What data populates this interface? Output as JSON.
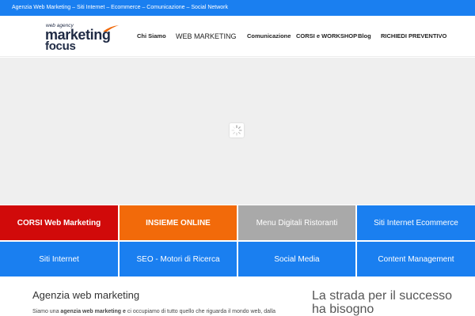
{
  "topbar": {
    "text": "Agenzia Web Marketing – Siti Internet – Ecommerce – Comunicazione – Social Network"
  },
  "logo": {
    "small": "web agency",
    "main": "marketing",
    "sub": "focus"
  },
  "nav": {
    "items": [
      {
        "label": "Chi Siamo"
      },
      {
        "label": "WEB MARKETING"
      },
      {
        "label": "Comunicazione"
      },
      {
        "label": "CORSI e WORKSHOP"
      },
      {
        "label": "Blog"
      },
      {
        "label": "RICHIEDI PREVENTIVO"
      }
    ]
  },
  "tiles": [
    {
      "label": "CORSI Web Marketing",
      "color": "#d10a0a"
    },
    {
      "label": "INSIEME ONLINE",
      "color": "#f26a0a"
    },
    {
      "label": "Menu Digitali Ristoranti",
      "color": "#a9a9a9"
    },
    {
      "label": "Siti Internet Ecommerce",
      "color": "#1a7ff0"
    },
    {
      "label": "Siti Internet",
      "color": "#1a7ff0"
    },
    {
      "label": "SEO - Motori di Ricerca",
      "color": "#1a7ff0"
    },
    {
      "label": "Social Media",
      "color": "#1a7ff0"
    },
    {
      "label": "Content Management",
      "color": "#1a7ff0"
    }
  ],
  "content": {
    "title": "Agenzia web marketing",
    "text_start": "Siamo una ",
    "text_bold": "agenzia web marketing e",
    "text_end": " ci occupiamo di tutto quello che riguarda il mondo web, dalla"
  },
  "side": {
    "title": "La strada per il successo ha bisogno"
  },
  "colors": {
    "brand_blue": "#1a7ff0",
    "logo_navy": "#1f2a44",
    "swoosh_orange": "#f26a0a"
  }
}
